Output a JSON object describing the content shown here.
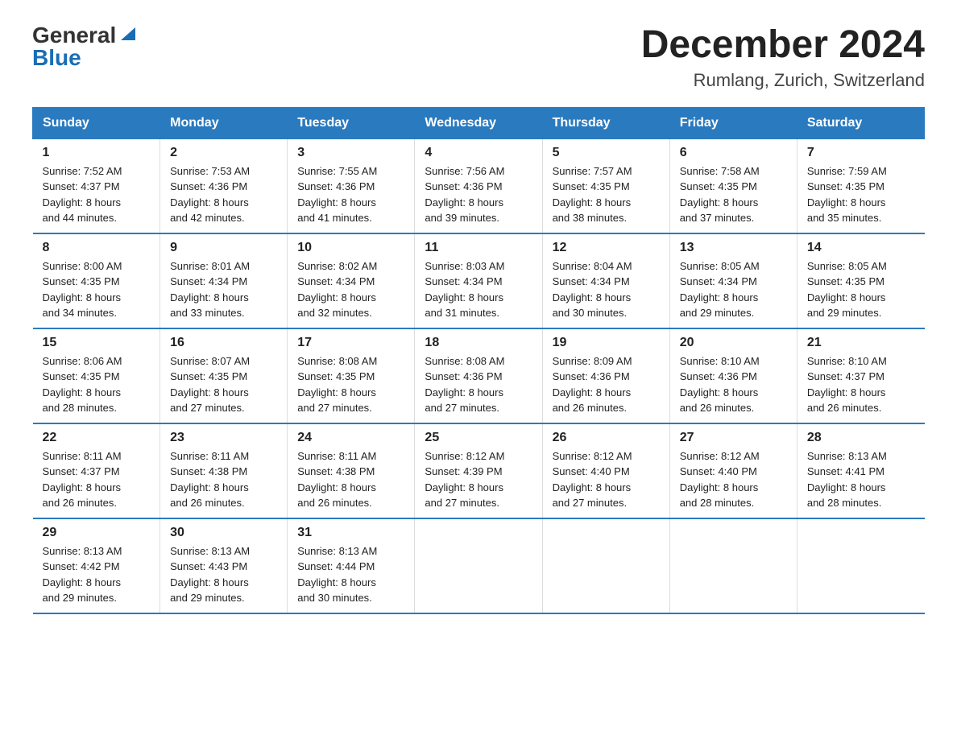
{
  "logo": {
    "general": "General",
    "blue": "Blue"
  },
  "title": "December 2024",
  "subtitle": "Rumlang, Zurich, Switzerland",
  "weekdays": [
    "Sunday",
    "Monday",
    "Tuesday",
    "Wednesday",
    "Thursday",
    "Friday",
    "Saturday"
  ],
  "weeks": [
    [
      {
        "day": "1",
        "sunrise": "7:52 AM",
        "sunset": "4:37 PM",
        "daylight": "8 hours and 44 minutes."
      },
      {
        "day": "2",
        "sunrise": "7:53 AM",
        "sunset": "4:36 PM",
        "daylight": "8 hours and 42 minutes."
      },
      {
        "day": "3",
        "sunrise": "7:55 AM",
        "sunset": "4:36 PM",
        "daylight": "8 hours and 41 minutes."
      },
      {
        "day": "4",
        "sunrise": "7:56 AM",
        "sunset": "4:36 PM",
        "daylight": "8 hours and 39 minutes."
      },
      {
        "day": "5",
        "sunrise": "7:57 AM",
        "sunset": "4:35 PM",
        "daylight": "8 hours and 38 minutes."
      },
      {
        "day": "6",
        "sunrise": "7:58 AM",
        "sunset": "4:35 PM",
        "daylight": "8 hours and 37 minutes."
      },
      {
        "day": "7",
        "sunrise": "7:59 AM",
        "sunset": "4:35 PM",
        "daylight": "8 hours and 35 minutes."
      }
    ],
    [
      {
        "day": "8",
        "sunrise": "8:00 AM",
        "sunset": "4:35 PM",
        "daylight": "8 hours and 34 minutes."
      },
      {
        "day": "9",
        "sunrise": "8:01 AM",
        "sunset": "4:34 PM",
        "daylight": "8 hours and 33 minutes."
      },
      {
        "day": "10",
        "sunrise": "8:02 AM",
        "sunset": "4:34 PM",
        "daylight": "8 hours and 32 minutes."
      },
      {
        "day": "11",
        "sunrise": "8:03 AM",
        "sunset": "4:34 PM",
        "daylight": "8 hours and 31 minutes."
      },
      {
        "day": "12",
        "sunrise": "8:04 AM",
        "sunset": "4:34 PM",
        "daylight": "8 hours and 30 minutes."
      },
      {
        "day": "13",
        "sunrise": "8:05 AM",
        "sunset": "4:34 PM",
        "daylight": "8 hours and 29 minutes."
      },
      {
        "day": "14",
        "sunrise": "8:05 AM",
        "sunset": "4:35 PM",
        "daylight": "8 hours and 29 minutes."
      }
    ],
    [
      {
        "day": "15",
        "sunrise": "8:06 AM",
        "sunset": "4:35 PM",
        "daylight": "8 hours and 28 minutes."
      },
      {
        "day": "16",
        "sunrise": "8:07 AM",
        "sunset": "4:35 PM",
        "daylight": "8 hours and 27 minutes."
      },
      {
        "day": "17",
        "sunrise": "8:08 AM",
        "sunset": "4:35 PM",
        "daylight": "8 hours and 27 minutes."
      },
      {
        "day": "18",
        "sunrise": "8:08 AM",
        "sunset": "4:36 PM",
        "daylight": "8 hours and 27 minutes."
      },
      {
        "day": "19",
        "sunrise": "8:09 AM",
        "sunset": "4:36 PM",
        "daylight": "8 hours and 26 minutes."
      },
      {
        "day": "20",
        "sunrise": "8:10 AM",
        "sunset": "4:36 PM",
        "daylight": "8 hours and 26 minutes."
      },
      {
        "day": "21",
        "sunrise": "8:10 AM",
        "sunset": "4:37 PM",
        "daylight": "8 hours and 26 minutes."
      }
    ],
    [
      {
        "day": "22",
        "sunrise": "8:11 AM",
        "sunset": "4:37 PM",
        "daylight": "8 hours and 26 minutes."
      },
      {
        "day": "23",
        "sunrise": "8:11 AM",
        "sunset": "4:38 PM",
        "daylight": "8 hours and 26 minutes."
      },
      {
        "day": "24",
        "sunrise": "8:11 AM",
        "sunset": "4:38 PM",
        "daylight": "8 hours and 26 minutes."
      },
      {
        "day": "25",
        "sunrise": "8:12 AM",
        "sunset": "4:39 PM",
        "daylight": "8 hours and 27 minutes."
      },
      {
        "day": "26",
        "sunrise": "8:12 AM",
        "sunset": "4:40 PM",
        "daylight": "8 hours and 27 minutes."
      },
      {
        "day": "27",
        "sunrise": "8:12 AM",
        "sunset": "4:40 PM",
        "daylight": "8 hours and 28 minutes."
      },
      {
        "day": "28",
        "sunrise": "8:13 AM",
        "sunset": "4:41 PM",
        "daylight": "8 hours and 28 minutes."
      }
    ],
    [
      {
        "day": "29",
        "sunrise": "8:13 AM",
        "sunset": "4:42 PM",
        "daylight": "8 hours and 29 minutes."
      },
      {
        "day": "30",
        "sunrise": "8:13 AM",
        "sunset": "4:43 PM",
        "daylight": "8 hours and 29 minutes."
      },
      {
        "day": "31",
        "sunrise": "8:13 AM",
        "sunset": "4:44 PM",
        "daylight": "8 hours and 30 minutes."
      },
      null,
      null,
      null,
      null
    ]
  ],
  "labels": {
    "sunrise": "Sunrise:",
    "sunset": "Sunset:",
    "daylight": "Daylight:"
  },
  "colors": {
    "header_bg": "#2a7abf",
    "border": "#2a7abf"
  }
}
